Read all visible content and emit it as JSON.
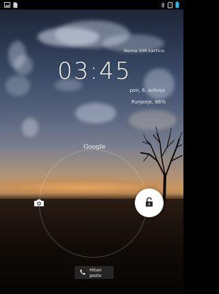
{
  "status_bar": {
    "left_icons": [
      "image-notification-icon",
      "document-notification-icon"
    ],
    "right_icons": [
      "bluetooth-icon",
      "no-sim-icon",
      "battery-icon"
    ]
  },
  "lockscreen": {
    "carrier_text": "Nema SIM kartice.",
    "clock_time": "03:45",
    "date_text": "pon, 6. svibnja",
    "charging_text": "Punjenje, 86%",
    "google_label": "Google",
    "camera_target_icon": "camera-icon",
    "unlock_handle_icon": "unlock-icon",
    "emergency_button_label": "Hitan poziv",
    "emergency_button_icon": "phone-icon"
  },
  "colors": {
    "text": "#ffffff",
    "handle": "#ffffff",
    "button_bg": "#282828"
  }
}
